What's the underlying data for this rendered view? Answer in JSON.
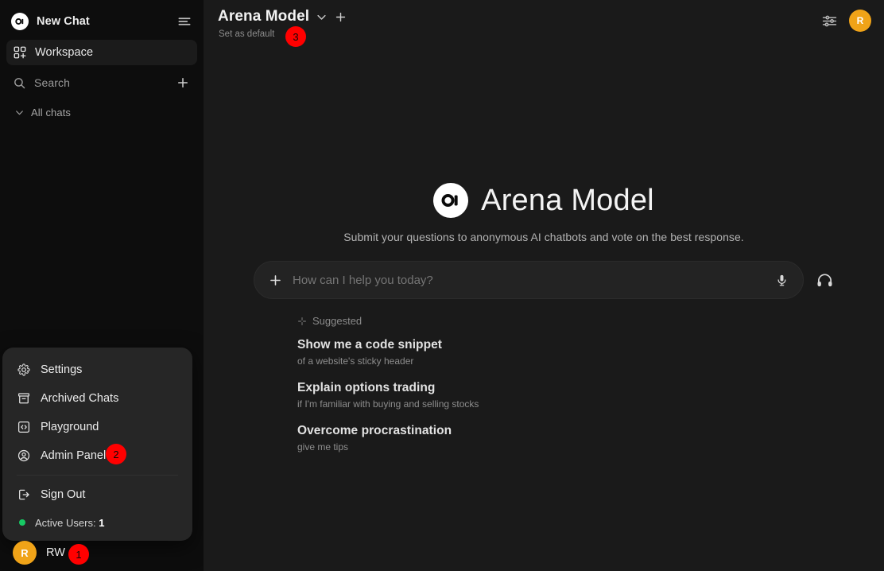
{
  "sidebar": {
    "new_chat_label": "New Chat",
    "menu_icon": "hamburger-icon",
    "workspace_label": "Workspace",
    "workspace_icon": "workspace-grid-plus-icon",
    "search_label": "Search",
    "search_icon": "search-icon",
    "new_icon": "plus-icon",
    "all_chats_label": "All chats",
    "all_chats_icon": "chevron-down-icon",
    "user": {
      "avatar_initial": "R",
      "name": "RW",
      "avatar_color": "#f0a318"
    }
  },
  "user_menu": {
    "items": [
      {
        "label": "Settings",
        "icon": "gear-icon"
      },
      {
        "label": "Archived Chats",
        "icon": "archive-icon"
      },
      {
        "label": "Playground",
        "icon": "code-brackets-icon"
      },
      {
        "label": "Admin Panel",
        "icon": "user-circle-icon"
      },
      {
        "label": "Sign Out",
        "icon": "sign-out-icon"
      }
    ],
    "status_label": "Active Users:",
    "status_count": "1",
    "status_dot_color": "#17c964"
  },
  "badges": [
    {
      "label": "1",
      "target": "user-profile-row",
      "color": "#ff0000"
    },
    {
      "label": "2",
      "target": "admin-panel-item",
      "color": "#ff0000"
    },
    {
      "label": "3",
      "target": "set-as-default",
      "color": "#ff0000"
    }
  ],
  "topbar": {
    "model_name": "Arena Model",
    "model_chevron_icon": "chevron-down-icon",
    "add_model_icon": "plus-icon",
    "set_as_default_label": "Set as default",
    "controls_icon": "sliders-icon",
    "avatar_initial": "R",
    "avatar_color": "#f0a318"
  },
  "hero": {
    "logo_icon": "open-webui-logo",
    "title": "Arena Model",
    "subtitle": "Submit your questions to anonymous AI chatbots and vote on the best response."
  },
  "composer": {
    "add_icon": "plus-icon",
    "placeholder": "How can I help you today?",
    "value": "",
    "mic_icon": "microphone-icon",
    "call_icon": "headphones-icon"
  },
  "suggested": {
    "header_label": "Suggested",
    "header_icon": "sparkle-icon",
    "items": [
      {
        "title": "Show me a code snippet",
        "subtitle": "of a website's sticky header"
      },
      {
        "title": "Explain options trading",
        "subtitle": "if I'm familiar with buying and selling stocks"
      },
      {
        "title": "Overcome procrastination",
        "subtitle": "give me tips"
      }
    ]
  }
}
